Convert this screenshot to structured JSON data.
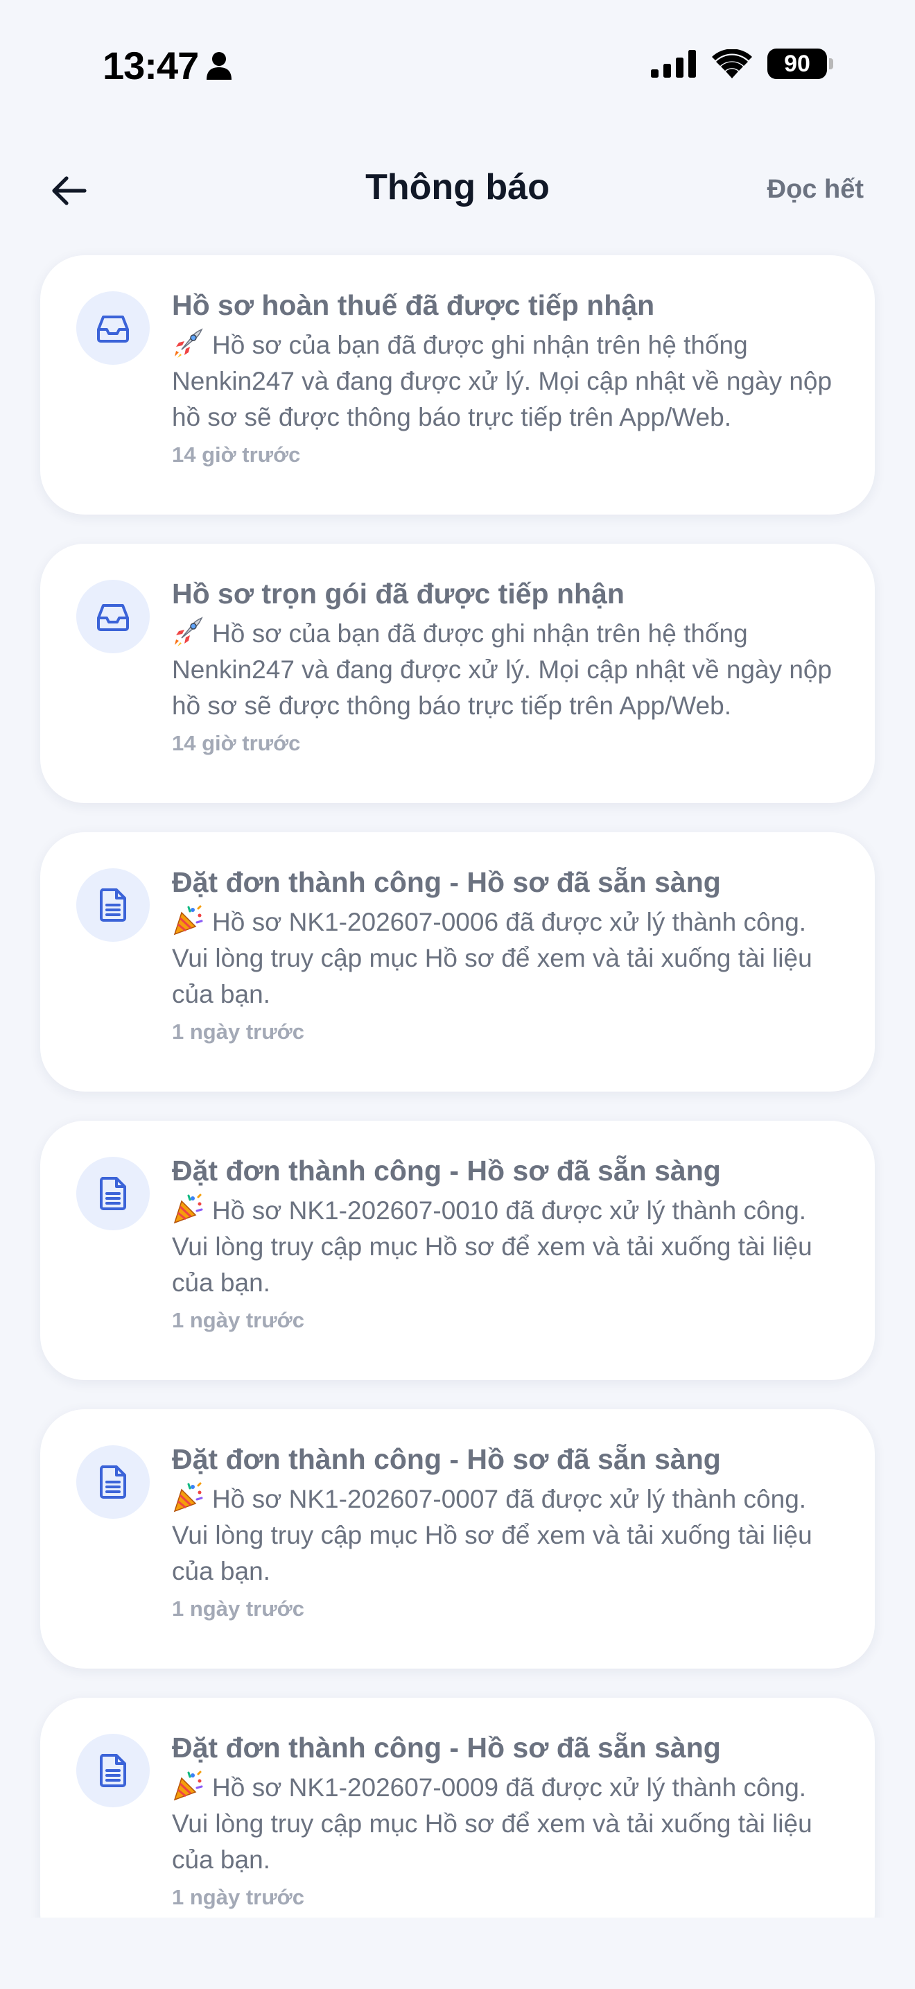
{
  "status_bar": {
    "time": "13:47",
    "battery": "90"
  },
  "header": {
    "title": "Thông báo",
    "read_all": "Đọc hết"
  },
  "notifications": [
    {
      "icon": "inbox-icon",
      "title": "Hồ sơ hoàn thuế đã được tiếp nhận",
      "emoji": "rocket",
      "message": "Hồ sơ của bạn đã được ghi nhận trên hệ thống Nenkin247 và đang được xử lý. Mọi cập nhật về ngày nộp hồ sơ sẽ được thông báo trực tiếp trên App/Web.",
      "time": "14 giờ trước"
    },
    {
      "icon": "inbox-icon",
      "title": "Hồ sơ trọn gói đã được tiếp nhận",
      "emoji": "rocket",
      "message": "Hồ sơ của bạn đã được ghi nhận trên hệ thống Nenkin247 và đang được xử lý. Mọi cập nhật về ngày nộp hồ sơ sẽ được thông báo trực tiếp trên App/Web.",
      "time": "14 giờ trước"
    },
    {
      "icon": "document-icon",
      "title": "Đặt đơn thành công - Hồ sơ đã sẵn sàng",
      "emoji": "party-popper",
      "message": "Hồ sơ NK1-202607-0006 đã được xử lý thành công. Vui lòng truy cập mục Hồ sơ để xem và tải xuống tài liệu của bạn.",
      "time": "1 ngày trước"
    },
    {
      "icon": "document-icon",
      "title": "Đặt đơn thành công - Hồ sơ đã sẵn sàng",
      "emoji": "party-popper",
      "message": "Hồ sơ NK1-202607-0010 đã được xử lý thành công. Vui lòng truy cập mục Hồ sơ để xem và tải xuống tài liệu của bạn.",
      "time": "1 ngày trước"
    },
    {
      "icon": "document-icon",
      "title": "Đặt đơn thành công - Hồ sơ đã sẵn sàng",
      "emoji": "party-popper",
      "message": "Hồ sơ NK1-202607-0007 đã được xử lý thành công. Vui lòng truy cập mục Hồ sơ để xem và tải xuống tài liệu của bạn.",
      "time": "1 ngày trước"
    },
    {
      "icon": "document-icon",
      "title": "Đặt đơn thành công - Hồ sơ đã sẵn sàng",
      "emoji": "party-popper",
      "message": "Hồ sơ NK1-202607-0009 đã được xử lý thành công. Vui lòng truy cập mục Hồ sơ để xem và tải xuống tài liệu của bạn.",
      "time": "1 ngày trước"
    }
  ],
  "colors": {
    "background": "#f4f6fb",
    "card": "#ffffff",
    "icon_bg": "#e9effd",
    "icon_fg": "#3b63d8",
    "text_muted": "#6b7280",
    "time_text": "#a3a9b6",
    "title": "#111827"
  }
}
